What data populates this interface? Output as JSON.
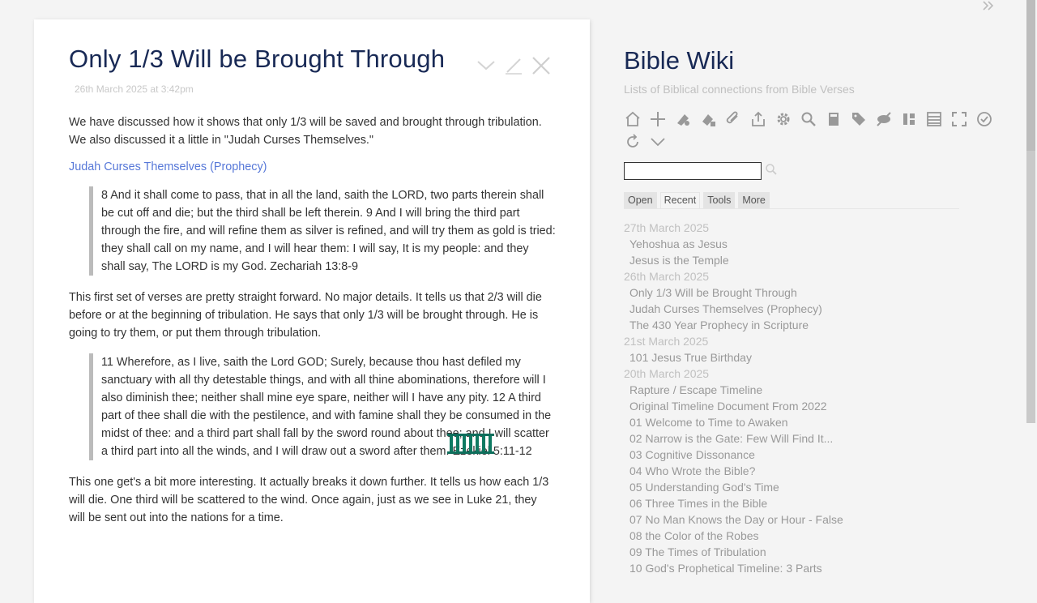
{
  "tiddler": {
    "title": "Only 1/3 Will be Brought Through",
    "date": "26th March 2025 at 3:42pm",
    "p1": "We have discussed how it shows that only 1/3 will be saved and brought through tribulation. We also discussed it a little in \"Judah Curses Themselves.\"",
    "link": "Judah Curses Themselves (Prophecy)",
    "quote1": "8 And it shall come to pass, that in all the land, saith the LORD, two parts therein shall be cut off and die; but the third shall be left therein. 9 And I will bring the third part through the fire, and will refine them as silver is refined, and will try them as gold is tried: they shall call on my name, and I will hear them: I will say, It is my people: and they shall say, The LORD is my God. Zechariah 13:8-9",
    "p2": "This first set of verses are pretty straight forward. No major details. It tells us that 2/3 will die before or at the beginning of tribulation. He says that only 1/3 will be brought through. He is going to try them, or put them through tribulation.",
    "quote2": "11 Wherefore, as I live, saith the Lord GOD; Surely, because thou hast defiled my sanctuary with all thy detestable things, and with all thine abominations, therefore will I also diminish thee; neither shall mine eye spare, neither will I have any pity. 12 A third part of thee shall die with the pestilence, and with famine shall they be consumed in the midst of thee: and a third part shall fall by the sword round about thee; and I will scatter a third part into all the winds, and I will draw out a sword after them. Ezekiel 5:11-12",
    "p3": "This one get's a bit more interesting. It actually breaks it down further. It tells us how each 1/3 will die. One third will be scattered to the wind. Once again, just as we see in Luke 21, they will be sent out into the nations for a time.",
    "controls": [
      "chevron-down-icon",
      "edit-icon",
      "close-icon"
    ]
  },
  "site": {
    "title": "Bible Wiki",
    "subtitle": "Lists of Biblical connections from Bible Verses"
  },
  "page_controls": [
    "home-icon",
    "new-tiddler-icon",
    "new-journal-icon",
    "new-image-icon",
    "attachment-icon",
    "export-icon",
    "settings-icon",
    "search-icon",
    "dictionary-icon",
    "tag-icon",
    "hide-icon",
    "layout-icon",
    "storyview-icon",
    "fullscreen-icon",
    "save-icon",
    "refresh-icon",
    "more-chevron-icon"
  ],
  "search": {
    "value": ""
  },
  "tabs": [
    {
      "label": "Open"
    },
    {
      "label": "Recent"
    },
    {
      "label": "Tools"
    },
    {
      "label": "More"
    }
  ],
  "recent": [
    {
      "date": "27th March 2025",
      "items": [
        "Yehoshua as Jesus",
        "Jesus is the Temple"
      ]
    },
    {
      "date": "26th March 2025",
      "items": [
        "Only 1/3 Will be Brought Through",
        "Judah Curses Themselves (Prophecy)",
        "The 430 Year Prophecy in Scripture"
      ]
    },
    {
      "date": "21st March 2025",
      "items": [
        "101 Jesus True Birthday"
      ]
    },
    {
      "date": "20th March 2025",
      "items": [
        "Rapture / Escape Timeline",
        "Original Timeline Document From 2022",
        "01 Welcome to Time to Awaken",
        "02 Narrow is the Gate: Few Will Find It...",
        "03 Cognitive Dissonance",
        "04 Who Wrote the Bible?",
        "05 Understanding God's Time",
        "06 Three Times in the Bible",
        "07 No Man Knows the Day or Hour - False",
        "08 the Color of the Robes",
        "09 The Times of Tribulation",
        "10 God's Prophetical Timeline: 3 Parts"
      ]
    }
  ]
}
